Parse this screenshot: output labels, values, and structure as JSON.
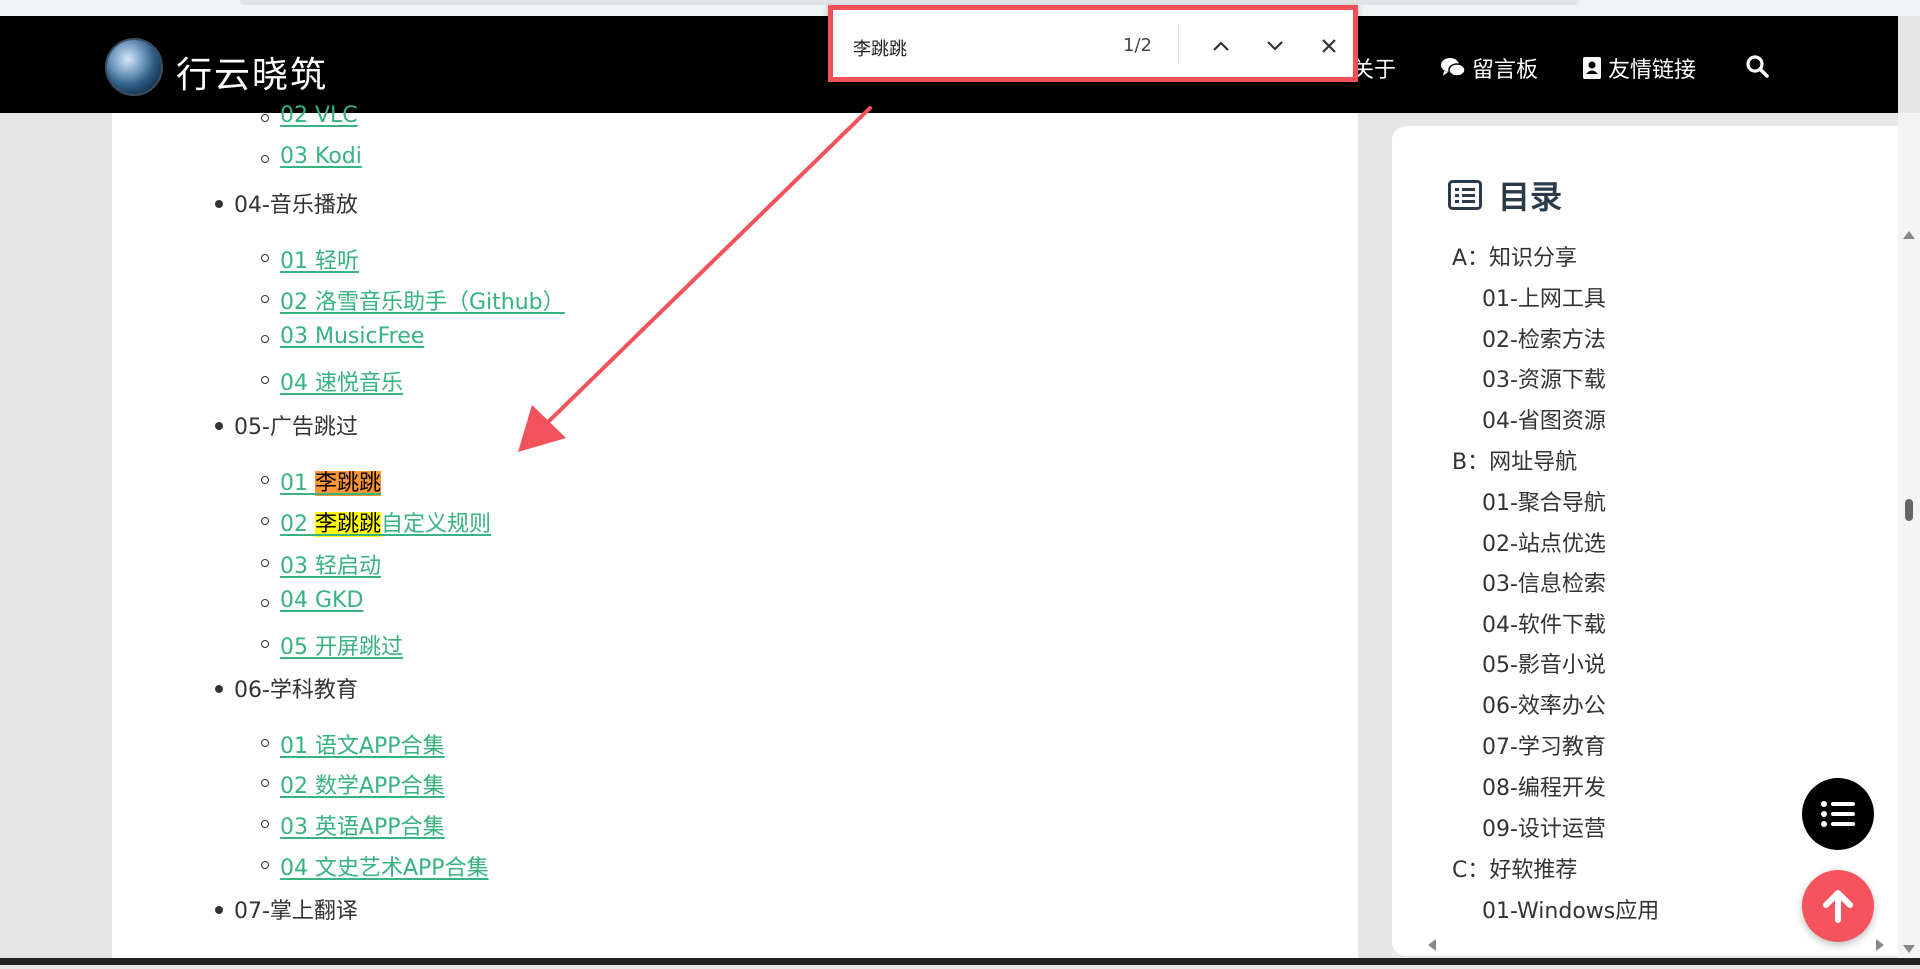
{
  "site": {
    "title": "行云晓筑"
  },
  "nav": {
    "about": "关于",
    "guestbook": "留言板",
    "links": "友情链接"
  },
  "find_bar": {
    "query": "李跳跳",
    "count": "1/2"
  },
  "article": {
    "items": [
      {
        "level": 2,
        "text": "02 VLC"
      },
      {
        "level": 2,
        "text": "03 Kodi"
      },
      {
        "level": 1,
        "text": "04-音乐播放"
      },
      {
        "level": 2,
        "text": "01 轻听"
      },
      {
        "level": 2,
        "text": "02 洛雪音乐助手（Github）"
      },
      {
        "level": 2,
        "text": "03 MusicFree"
      },
      {
        "level": 2,
        "text": "04 速悦音乐"
      },
      {
        "level": 1,
        "text": "05-广告跳过"
      },
      {
        "level": 2,
        "prefix": "01 ",
        "match": "李跳跳",
        "suffix": "",
        "highlight": "current"
      },
      {
        "level": 2,
        "prefix": "02 ",
        "match": "李跳跳",
        "suffix": "自定义规则",
        "highlight": "other"
      },
      {
        "level": 2,
        "text": "03 轻启动"
      },
      {
        "level": 2,
        "text": "04 GKD"
      },
      {
        "level": 2,
        "text": "05 开屏跳过"
      },
      {
        "level": 1,
        "text": "06-学科教育"
      },
      {
        "level": 2,
        "text": "01 语文APP合集"
      },
      {
        "level": 2,
        "text": "02 数学APP合集"
      },
      {
        "level": 2,
        "text": "03 英语APP合集"
      },
      {
        "level": 2,
        "text": "04 文史艺术APP合集"
      },
      {
        "level": 1,
        "text": "07-掌上翻译"
      }
    ]
  },
  "sidebar": {
    "heading": "目录",
    "items": [
      {
        "level": 1,
        "text": "A：知识分享"
      },
      {
        "level": 2,
        "text": "01-上网工具"
      },
      {
        "level": 2,
        "text": "02-检索方法"
      },
      {
        "level": 2,
        "text": "03-资源下载"
      },
      {
        "level": 2,
        "text": "04-省图资源"
      },
      {
        "level": 1,
        "text": "B：网址导航"
      },
      {
        "level": 2,
        "text": "01-聚合导航"
      },
      {
        "level": 2,
        "text": "02-站点优选"
      },
      {
        "level": 2,
        "text": "03-信息检索"
      },
      {
        "level": 2,
        "text": "04-软件下载"
      },
      {
        "level": 2,
        "text": "05-影音小说"
      },
      {
        "level": 2,
        "text": "06-效率办公"
      },
      {
        "level": 2,
        "text": "07-学习教育"
      },
      {
        "level": 2,
        "text": "08-编程开发"
      },
      {
        "level": 2,
        "text": "09-设计运营"
      },
      {
        "level": 1,
        "text": "C：好软推荐"
      },
      {
        "level": 2,
        "text": "01-Windows应用"
      }
    ]
  },
  "colors": {
    "link": "#36b37e",
    "find_border": "#f25058",
    "current_match": "#ff9632",
    "other_match": "#ffff00",
    "fab_top": "#f5545e"
  },
  "icons": {
    "search": "search-icon",
    "chat": "chat-icon",
    "contact": "contact-card-icon",
    "up": "chevron-up-icon",
    "down": "chevron-down-icon",
    "close": "close-icon",
    "list": "list-icon",
    "arrow_up": "arrow-up-icon"
  }
}
